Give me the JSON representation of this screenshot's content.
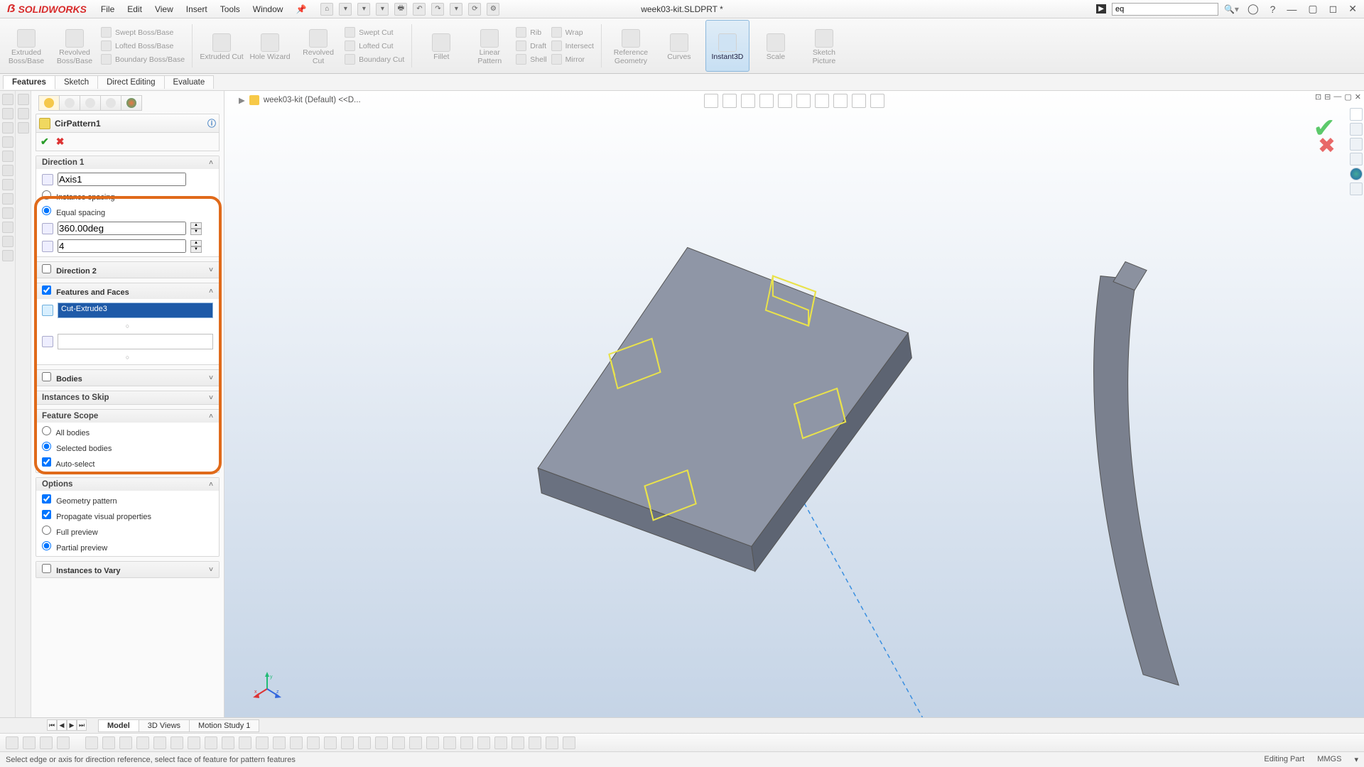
{
  "app": {
    "brand": "SOLIDWORKS",
    "doc_title": "week03-kit.SLDPRT *",
    "search_value": "eq"
  },
  "menu": {
    "file": "File",
    "edit": "Edit",
    "view": "View",
    "insert": "Insert",
    "tools": "Tools",
    "window": "Window"
  },
  "ribbon": {
    "tabs": {
      "features": "Features",
      "sketch": "Sketch",
      "direct": "Direct Editing",
      "evaluate": "Evaluate"
    },
    "big": {
      "extr_boss": "Extruded Boss/Base",
      "rev_boss": "Revolved Boss/Base",
      "extr_cut": "Extruded Cut",
      "hole": "Hole Wizard",
      "rev_cut": "Revolved Cut",
      "fillet": "Fillet",
      "lin_pat": "Linear Pattern",
      "ref_geom": "Reference Geometry",
      "curves": "Curves",
      "instant3d": "Instant3D",
      "scale": "Scale",
      "sketch_pic": "Sketch Picture"
    },
    "small": {
      "swept_boss": "Swept Boss/Base",
      "lofted_boss": "Lofted Boss/Base",
      "boundary_boss": "Boundary Boss/Base",
      "swept_cut": "Swept Cut",
      "lofted_cut": "Lofted Cut",
      "boundary_cut": "Boundary Cut",
      "rib": "Rib",
      "draft": "Draft",
      "shell": "Shell",
      "wrap": "Wrap",
      "intersect": "Intersect",
      "mirror": "Mirror"
    }
  },
  "breadcrumb": {
    "label": "week03-kit (Default) <<D..."
  },
  "pm": {
    "title": "CirPattern1",
    "dir1": {
      "head": "Direction 1",
      "axis": "Axis1",
      "instance_spacing": "Instance spacing",
      "equal_spacing": "Equal spacing",
      "angle": "360.00deg",
      "count": "4"
    },
    "dir2": {
      "head": "Direction 2"
    },
    "features": {
      "head": "Features and Faces",
      "item1": "Cut-Extrude3"
    },
    "bodies": {
      "head": "Bodies"
    },
    "skip": {
      "head": "Instances to Skip"
    },
    "scope": {
      "head": "Feature Scope",
      "all": "All bodies",
      "sel": "Selected bodies",
      "auto": "Auto-select"
    },
    "options": {
      "head": "Options",
      "geom": "Geometry pattern",
      "prop": "Propagate visual properties",
      "full": "Full preview",
      "partial": "Partial preview"
    },
    "vary": {
      "head": "Instances to Vary"
    }
  },
  "bottom": {
    "model": "Model",
    "views3d": "3D Views",
    "motion": "Motion Study 1"
  },
  "status": {
    "hint": "Select edge or axis for direction reference, select face of feature for pattern features",
    "mode": "Editing Part",
    "units": "MMGS"
  }
}
